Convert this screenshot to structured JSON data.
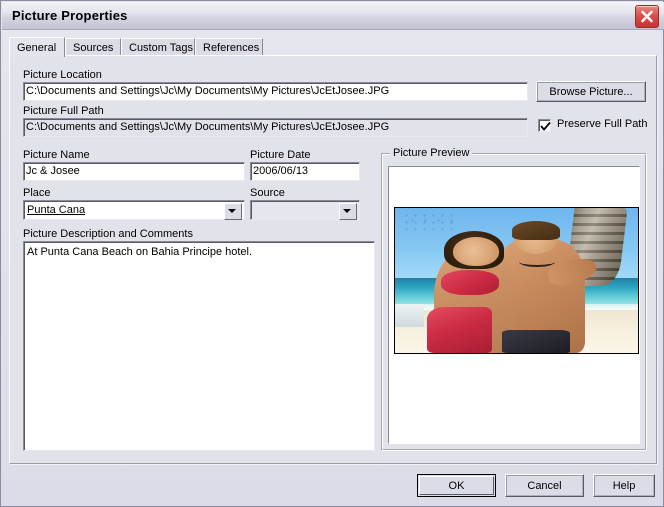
{
  "window": {
    "title": "Picture Properties",
    "close_icon": "close-x-icon"
  },
  "tabs": [
    {
      "label": "General",
      "active": true
    },
    {
      "label": "Sources",
      "active": false
    },
    {
      "label": "Custom Tags",
      "active": false
    },
    {
      "label": "References",
      "active": false
    }
  ],
  "general": {
    "picture_location": {
      "label": "Picture Location",
      "value": "C:\\Documents and Settings\\Jc\\My Documents\\My Pictures\\JcEtJosee.JPG"
    },
    "picture_full_path": {
      "label": "Picture Full Path",
      "value": "C:\\Documents and Settings\\Jc\\My Documents\\My Pictures\\JcEtJosee.JPG"
    },
    "browse_button": "Browse Picture...",
    "preserve_full_path": {
      "label": "Preserve Full Path",
      "checked": true
    },
    "picture_name": {
      "label": "Picture Name",
      "value": "Jc & Josee"
    },
    "picture_date": {
      "label": "Picture Date",
      "value": "2006/06/13"
    },
    "place": {
      "label": "Place",
      "value": "Punta Cana"
    },
    "source": {
      "label": "Source",
      "value": ""
    },
    "description": {
      "label": "Picture Description and Comments",
      "value": "At Punta Cana Beach on Bahia Principe hotel."
    },
    "preview": {
      "label": "Picture Preview",
      "image_alt": "beach-photo-couple"
    }
  },
  "footer": {
    "ok": "OK",
    "cancel": "Cancel",
    "help": "Help"
  },
  "colors": {
    "dialog_face": "#e2e2ea",
    "titlebar_top": "#f2f2f7",
    "close_red": "#c43430",
    "field_white": "#ffffff"
  }
}
